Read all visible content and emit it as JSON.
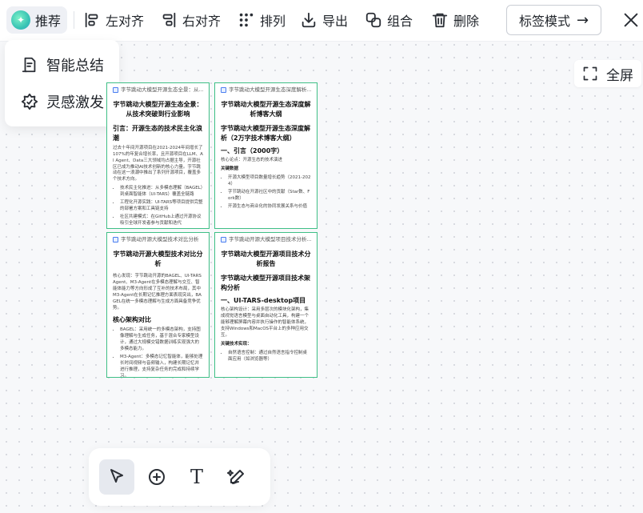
{
  "toolbar": {
    "recommend": "推荐",
    "align_left": "左对齐",
    "align_right": "右对齐",
    "arrange": "排列",
    "export": "导出",
    "group": "组合",
    "delete": "删除",
    "tag_mode": "标签模式",
    "tag_mode_arrow": "→"
  },
  "dropdown": {
    "items": [
      {
        "label": "智能总结",
        "icon": "summary-icon"
      },
      {
        "label": "灵感激发",
        "icon": "inspiration-icon"
      }
    ]
  },
  "fullscreen": {
    "label": "全屏"
  },
  "cards": [
    {
      "header": "字节跳动大模型开源生态全景：从...",
      "title": "字节跳动大模型开源生态全景：从技术突破到行业影响",
      "section": "引言：开源生态的技术民主化浪潮",
      "para": "过去十年间开源项目在2021-2024年间增长了107%的年复合增长率，且开源项目在LLM、AI Agent、Data三大领域均占据主导，开源社区已成为推动AI技术创新的核心力量。字节跳动在这一浪潮中推出了系列开源项目，覆盖多个技术方向。",
      "bullets": [
        "技术民主化推进：从多模态理解（BAGEL）到桌面智能体（UI-TARS）覆盖全链路",
        "工程化开源实践：UI-TARS等项目提供完整的部署方案和工具链支持",
        "社区共建模式：在GitHub上通过开源协议吸引全球开发者参与贡献和迭代"
      ]
    },
    {
      "header": "字节跳动大模型开源生态深度解析...",
      "title": "字节跳动大模型开源生态深度解析博客大纲",
      "subtitle": "字节跳动大模型开源生态深度解析（2万字技术博客大纲）",
      "section": "一、引言（2000字）",
      "para": "核心论点：开源生态的技术演进",
      "para2": "关键数据",
      "bullets": [
        "开源大模型项目数量增长趋势（2021-2024）",
        "字节跳动在开源社区中的贡献（Star数、Fork数）",
        "开源生态与商业化的协同发展关系与价值"
      ]
    },
    {
      "header": "字节跳动开源大模型技术对比分析",
      "title": "字节跳动开源大模型技术对比分析",
      "para": "核心发现：字节跳动开源的BAGEL、UI-TARS Agent、M3-Agent在多模态理解与交互、智能体能力等方向形成了互补的技术布局，其中M3-Agent在长期记忆推理方面表现突出，BAGEL在统一多模态理解与生成方面具备竞争优势。",
      "section": "核心架构对比",
      "bullets": [
        "BAGEL：采用统一的多模态架构，支持图像理解与生成任务，基于混合专家模型设计，通过大规模交错数据训练实现强大的多模态能力。",
        "M3-Agent：多模态记忆智能体，能够处理长时间视频与音频输入，构建长期记忆并进行推理，支持复杂任务的完成和持续学习。"
      ]
    },
    {
      "header": "字节跳动开源大模型项目技术分析...",
      "title": "字节跳动大模型开源项目技术分析报告",
      "subtitle": "字节跳动大模型开源项目技术架构分析",
      "section": "一、UI-TARS-desktop项目",
      "para": "核心架构设计：采用多层次的模块化架构，集成视觉语言模型与桌面自动化工具，构建一个能够理解屏幕内容并执行操作的智能体系统，支持Windows和MacOS平台上的多种应用交互。",
      "para2": "关键技术实现：",
      "bullets": [
        "自然语言控制：通过自然语言指令控制桌面应用（如浏览器等）"
      ]
    }
  ],
  "palette": {
    "tools": [
      "select-tool",
      "add-tool",
      "text-tool",
      "ai-draw-tool"
    ],
    "text_glyph": "T"
  }
}
